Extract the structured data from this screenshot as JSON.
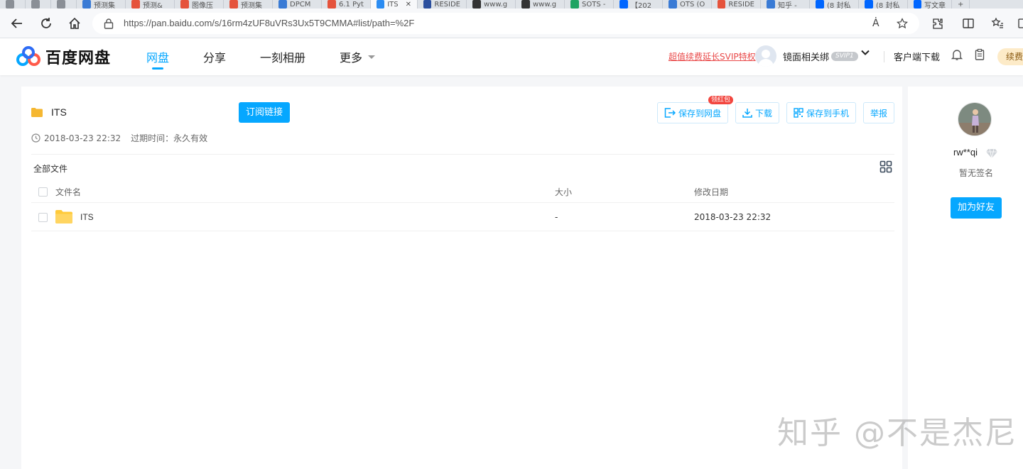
{
  "browser": {
    "tabs": [
      {
        "label": "",
        "icon": "profile-icon",
        "color": "#8a8f96"
      },
      {
        "label": "",
        "icon": "collections-icon",
        "color": "#8a8f96"
      },
      {
        "label": "",
        "icon": "tab-actions-icon",
        "color": "#8a8f96"
      },
      {
        "label": "预测集",
        "icon": "search-icon",
        "color": "#3a7bd5"
      },
      {
        "label": "预测&",
        "icon": "csdn-icon",
        "color": "#e5533c"
      },
      {
        "label": "图像压",
        "icon": "csdn-icon",
        "color": "#e5533c"
      },
      {
        "label": "预测集",
        "icon": "csdn-icon",
        "color": "#e5533c"
      },
      {
        "label": "DPCM",
        "icon": "search-icon",
        "color": "#3a7bd5"
      },
      {
        "label": "6.1 Pyt",
        "icon": "csdn-icon",
        "color": "#e5533c"
      },
      {
        "label": "ITS",
        "icon": "baidu-pan-icon",
        "color": "#2b8cf2",
        "active": true
      },
      {
        "label": "RESIDE",
        "icon": "grid-icon",
        "color": "#2b4f9e"
      },
      {
        "label": "www.g",
        "icon": "github-icon",
        "color": "#333333"
      },
      {
        "label": "www.g",
        "icon": "github-icon",
        "color": "#333333"
      },
      {
        "label": "SOTS -",
        "icon": "drive-icon",
        "color": "#1fa463"
      },
      {
        "label": "【202",
        "icon": "zhihu-icon",
        "color": "#0066ff"
      },
      {
        "label": "OTS (O",
        "icon": "search-icon",
        "color": "#3a7bd5"
      },
      {
        "label": "RESIDE",
        "icon": "csdn-icon",
        "color": "#e5533c"
      },
      {
        "label": "知乎 -",
        "icon": "search-icon",
        "color": "#3a7bd5"
      },
      {
        "label": "(8 封私",
        "icon": "zhihu-icon",
        "color": "#0066ff"
      },
      {
        "label": "(8 封私",
        "icon": "zhihu-icon",
        "color": "#0066ff"
      },
      {
        "label": "写文章",
        "icon": "zhihu-icon",
        "color": "#0066ff"
      }
    ],
    "new_tab": "+",
    "url": "https://pan.baidu.com/s/16rm4zUF8uVRs3Ux5T9CMMA#list/path=%2F",
    "read_aloud": "Ȧ"
  },
  "header": {
    "logo_text": "百度网盘",
    "nav": [
      {
        "label": "网盘",
        "active": true
      },
      {
        "label": "分享"
      },
      {
        "label": "一刻相册"
      },
      {
        "label": "更多",
        "has_caret": true
      }
    ],
    "svip_promo": "超值续费延长SVIP特权",
    "username": "镜面相关绑",
    "svip_badge": "SVIP1",
    "client_download": "客户端下载",
    "renew_label": "续费"
  },
  "share": {
    "folder_title": "ITS",
    "subscribe_label": "订阅链接",
    "created": "2018-03-23 22:32",
    "expiry": "过期时间：永久有效",
    "actions": {
      "save_to_pan": "保存到网盘",
      "redpack_badge": "领红包",
      "download": "下载",
      "save_to_phone": "保存到手机",
      "report": "举报"
    },
    "breadcrumb": "全部文件",
    "columns": {
      "name": "文件名",
      "size": "大小",
      "modified": "修改日期"
    },
    "files": [
      {
        "name": "ITS",
        "size": "-",
        "modified": "2018-03-23 22:32"
      }
    ]
  },
  "sidebar": {
    "username": "rw**qi",
    "signature": "暂无签名",
    "add_friend": "加为好友"
  },
  "watermark": "知乎 @不是杰尼",
  "colors": {
    "accent": "#06a7ff",
    "promo_red": "#e94a4a",
    "folder_yellow": "#ffca3a"
  }
}
